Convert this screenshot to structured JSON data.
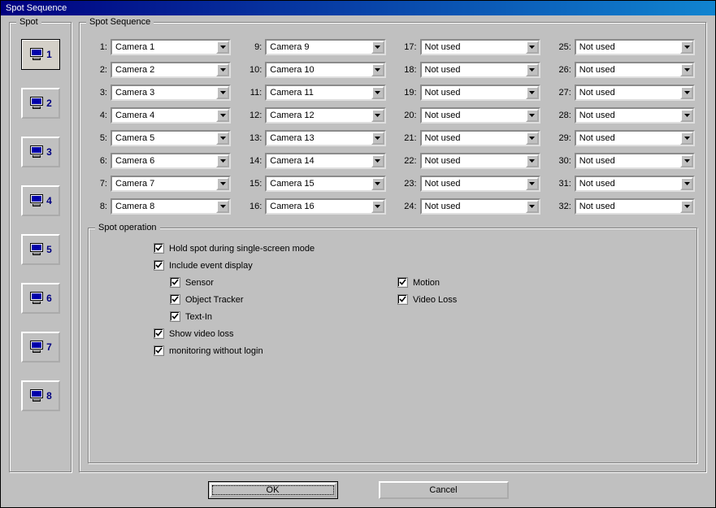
{
  "window": {
    "title": "Spot Sequence"
  },
  "spot_group": {
    "legend": "Spot",
    "active": 1,
    "buttons": [
      1,
      2,
      3,
      4,
      5,
      6,
      7,
      8
    ]
  },
  "sequence_group": {
    "legend": "Spot Sequence",
    "slots": [
      {
        "n": 1,
        "v": "Camera 1"
      },
      {
        "n": 2,
        "v": "Camera 2"
      },
      {
        "n": 3,
        "v": "Camera 3"
      },
      {
        "n": 4,
        "v": "Camera 4"
      },
      {
        "n": 5,
        "v": "Camera 5"
      },
      {
        "n": 6,
        "v": "Camera 6"
      },
      {
        "n": 7,
        "v": "Camera 7"
      },
      {
        "n": 8,
        "v": "Camera 8"
      },
      {
        "n": 9,
        "v": "Camera 9"
      },
      {
        "n": 10,
        "v": "Camera 10"
      },
      {
        "n": 11,
        "v": "Camera 11"
      },
      {
        "n": 12,
        "v": "Camera 12"
      },
      {
        "n": 13,
        "v": "Camera 13"
      },
      {
        "n": 14,
        "v": "Camera 14"
      },
      {
        "n": 15,
        "v": "Camera 15"
      },
      {
        "n": 16,
        "v": "Camera 16"
      },
      {
        "n": 17,
        "v": "Not used"
      },
      {
        "n": 18,
        "v": "Not used"
      },
      {
        "n": 19,
        "v": "Not used"
      },
      {
        "n": 20,
        "v": "Not used"
      },
      {
        "n": 21,
        "v": "Not used"
      },
      {
        "n": 22,
        "v": "Not used"
      },
      {
        "n": 23,
        "v": "Not used"
      },
      {
        "n": 24,
        "v": "Not used"
      },
      {
        "n": 25,
        "v": "Not used"
      },
      {
        "n": 26,
        "v": "Not used"
      },
      {
        "n": 27,
        "v": "Not used"
      },
      {
        "n": 28,
        "v": "Not used"
      },
      {
        "n": 29,
        "v": "Not used"
      },
      {
        "n": 30,
        "v": "Not used"
      },
      {
        "n": 31,
        "v": "Not used"
      },
      {
        "n": 32,
        "v": "Not used"
      }
    ]
  },
  "operation_group": {
    "legend": "Spot operation",
    "hold_spot": {
      "label": "Hold spot during single-screen mode",
      "checked": true
    },
    "include_event": {
      "label": "Include event display",
      "checked": true
    },
    "events": {
      "sensor": {
        "label": "Sensor",
        "checked": true
      },
      "motion": {
        "label": "Motion",
        "checked": true
      },
      "object_tracker": {
        "label": "Object Tracker",
        "checked": true
      },
      "video_loss": {
        "label": "Video Loss",
        "checked": true
      },
      "text_in": {
        "label": "Text-In",
        "checked": true
      }
    },
    "show_video_loss": {
      "label": "Show video loss",
      "checked": true
    },
    "monitoring_no_login": {
      "label": "monitoring without login",
      "checked": true
    }
  },
  "buttons": {
    "ok": "OK",
    "cancel": "Cancel"
  }
}
